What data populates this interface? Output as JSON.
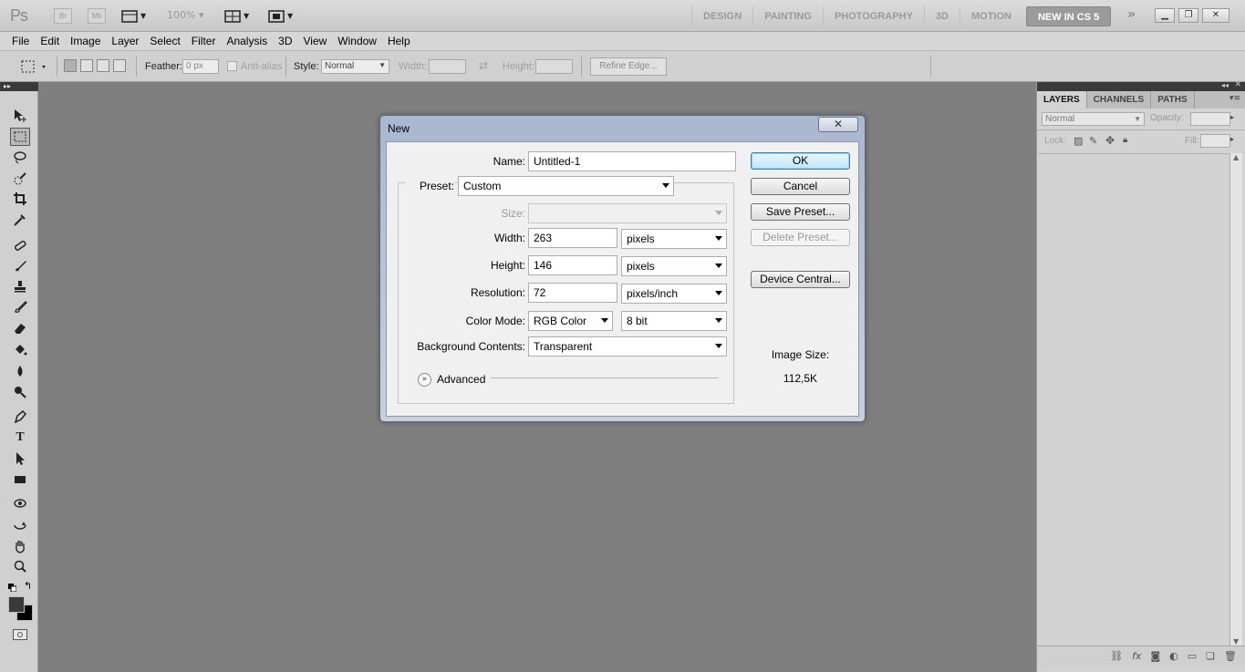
{
  "appbar": {
    "logo": "Ps",
    "bridge": "Br",
    "minibridge": "Mb",
    "zoom": "100%",
    "workspaces": [
      "DESIGN",
      "PAINTING",
      "PHOTOGRAPHY",
      "3D",
      "MOTION"
    ],
    "active_workspace": "NEW IN CS 5",
    "more": "»"
  },
  "menu": [
    "File",
    "Edit",
    "Image",
    "Layer",
    "Select",
    "Filter",
    "Analysis",
    "3D",
    "View",
    "Window",
    "Help"
  ],
  "options": {
    "feather_label": "Feather:",
    "feather_value": "0 px",
    "antialias_label": "Anti-alias",
    "style_label": "Style:",
    "style_value": "Normal",
    "width_label": "Width:",
    "height_label": "Height:",
    "refine_edge": "Refine Edge..."
  },
  "panel": {
    "tabs": [
      "LAYERS",
      "CHANNELS",
      "PATHS"
    ],
    "blend_mode": "Normal",
    "opacity_label": "Opacity:",
    "lock_label": "Lock:",
    "fill_label": "Fill:"
  },
  "dialog": {
    "title": "New",
    "close": "✕",
    "name_label": "Name:",
    "name_value": "Untitled-1",
    "preset_label": "Preset:",
    "preset_value": "Custom",
    "size_label": "Size:",
    "width_label": "Width:",
    "width_value": "263",
    "width_unit": "pixels",
    "height_label": "Height:",
    "height_value": "146",
    "height_unit": "pixels",
    "resolution_label": "Resolution:",
    "resolution_value": "72",
    "resolution_unit": "pixels/inch",
    "colormode_label": "Color Mode:",
    "colormode_value": "RGB Color",
    "bitdepth_value": "8 bit",
    "bg_label": "Background Contents:",
    "bg_value": "Transparent",
    "advanced_label": "Advanced",
    "ok": "OK",
    "cancel": "Cancel",
    "save_preset": "Save Preset...",
    "delete_preset": "Delete Preset...",
    "device_central": "Device Central...",
    "image_size_label": "Image Size:",
    "image_size_value": "112,5K"
  }
}
